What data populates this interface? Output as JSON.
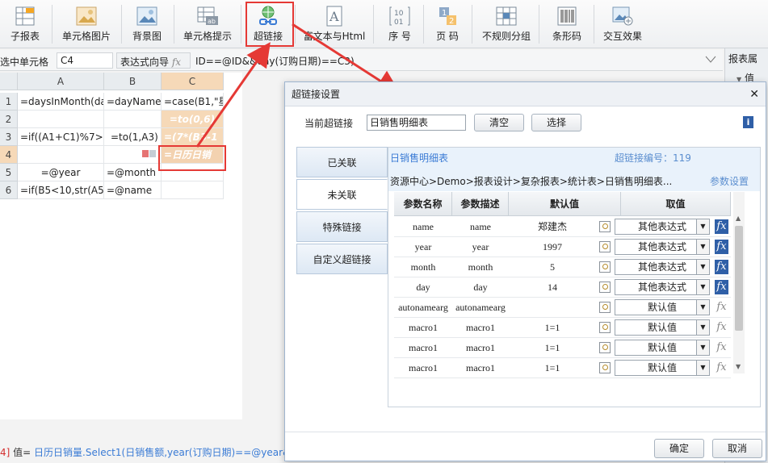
{
  "toolbar": {
    "items": [
      {
        "label": "子报表",
        "icon": "subreport-icon"
      },
      {
        "label": "单元格图片",
        "icon": "cell-image-icon"
      },
      {
        "label": "背景图",
        "icon": "background-image-icon"
      },
      {
        "label": "单元格提示",
        "icon": "cell-tooltip-icon"
      },
      {
        "label": "超链接",
        "icon": "hyperlink-icon"
      },
      {
        "label": "富文本与Html",
        "icon": "richtext-icon"
      },
      {
        "label": "序 号",
        "icon": "serial-number-icon"
      },
      {
        "label": "页 码",
        "icon": "page-number-icon"
      },
      {
        "label": "不规则分组",
        "icon": "irregular-group-icon"
      },
      {
        "label": "条形码",
        "icon": "barcode-icon"
      },
      {
        "label": "交互效果",
        "icon": "interaction-icon"
      }
    ]
  },
  "formula_bar": {
    "selected_cell_label": "选中单元格",
    "cell_ref": "C4",
    "expr_wizard_label": "表达式向导",
    "fx_symbol": "fx",
    "expression": "ID==@ID&&day(订购日期)==C3)"
  },
  "right_strip": {
    "label": "报表属",
    "sub": "值"
  },
  "sheet": {
    "columns": [
      "A",
      "B",
      "C"
    ],
    "rows": [
      "1",
      "2",
      "3",
      "4",
      "5",
      "6"
    ],
    "cells": {
      "A1": "=daysInMonth(da",
      "B1": "=dayName(",
      "C1": "=case(B1,\"星",
      "C2": "=to(0,6)",
      "A3": "=if((A1+C1)%7>0,",
      "B3": "=to(1,A3)",
      "C3": "=(7*(B3-1",
      "C4": "=日历日销",
      "A5": "=@year",
      "B5": "=@month",
      "A6": "=if(B5<10,str(A5)-",
      "B6": "=@name"
    }
  },
  "status": {
    "ref": "4]",
    "prefix": "值=",
    "expr": "日历日销量.Select1(日销售额,year(订购日期)==@year&&"
  },
  "dialog": {
    "title": "超链接设置",
    "current_label": "当前超链接",
    "current_value": "日销售明细表",
    "clear_btn": "清空",
    "select_btn": "选择",
    "info_icon": "i",
    "tabs": [
      "已关联",
      "未关联",
      "特殊链接",
      "自定义超链接"
    ],
    "active_tab": 1,
    "report_name": "日销售明细表",
    "link_no": "超链接编号：119",
    "path": "资源中心>Demo>报表设计>复杂报表>统计表>日销售明细表...",
    "param_settings": "参数设置",
    "table_headers": [
      "参数名称",
      "参数描述",
      "默认值",
      "取值"
    ],
    "rows": [
      {
        "name": "name",
        "desc": "name",
        "default": "郑建杰",
        "value": "其他表达式",
        "fx_on": true
      },
      {
        "name": "year",
        "desc": "year",
        "default": "1997",
        "value": "其他表达式",
        "fx_on": true
      },
      {
        "name": "month",
        "desc": "month",
        "default": "5",
        "value": "其他表达式",
        "fx_on": true
      },
      {
        "name": "day",
        "desc": "day",
        "default": "14",
        "value": "其他表达式",
        "fx_on": true
      },
      {
        "name": "autonamearg",
        "desc": "autonamearg",
        "default": "",
        "value": "默认值",
        "fx_on": false
      },
      {
        "name": "macro1",
        "desc": "macro1",
        "default": "1=1",
        "value": "默认值",
        "fx_on": false
      },
      {
        "name": "macro1",
        "desc": "macro1",
        "default": "1=1",
        "value": "默认值",
        "fx_on": false
      },
      {
        "name": "macro1",
        "desc": "macro1",
        "default": "1=1",
        "value": "默认值",
        "fx_on": false
      }
    ],
    "ok_btn": "确定",
    "cancel_btn": "取消"
  },
  "colors": {
    "highlight": "#e53935",
    "accent": "#2f5fa7",
    "link": "#3a7bd5"
  }
}
